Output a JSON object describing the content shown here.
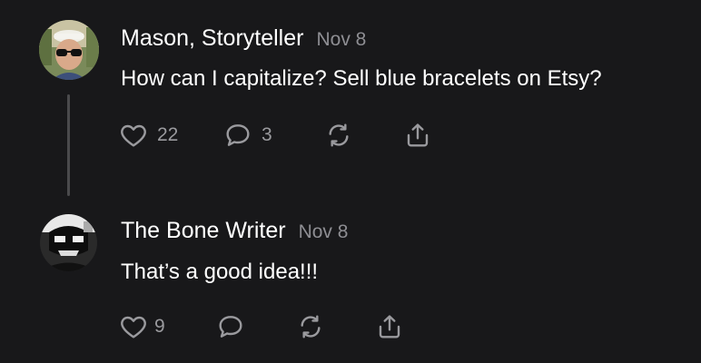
{
  "comments": [
    {
      "author": "Mason, Storyteller",
      "date": "Nov 8",
      "text": "How can I capitalize? Sell blue bracelets on Etsy?",
      "likes": "22",
      "replies": "3"
    },
    {
      "author": "The Bone Writer",
      "date": "Nov 8",
      "text": "That’s a good idea!!!",
      "likes": "9"
    }
  ],
  "colors": {
    "background": "#18181a",
    "text": "#ffffff",
    "muted": "#8e8e93",
    "icon": "#9a9a9e",
    "thread_line": "#4a4a4c"
  },
  "icons": {
    "like": "heart-icon",
    "comment": "comment-bubble-icon",
    "restack": "restack-icon",
    "share": "share-icon"
  }
}
